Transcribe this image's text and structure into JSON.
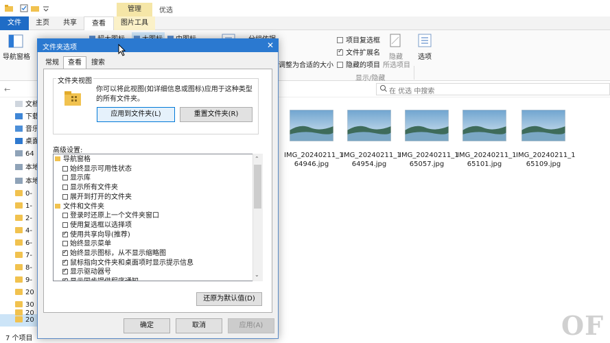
{
  "titlebar": {
    "context_tab": "管理",
    "window_title": "优选"
  },
  "tabs": {
    "file": "文件",
    "home": "主页",
    "share": "共享",
    "view": "查看",
    "picture_tools": "图片工具"
  },
  "ribbon": {
    "nav_pane": "导航窗格",
    "layout_extra_large": "超大图标",
    "layout_large": "大图标",
    "layout_medium": "中图标",
    "group_by": "分组依据",
    "fit_columns": "调整为合适的大小",
    "item_checkboxes": "项目复选框",
    "file_extensions": "文件扩展名",
    "hidden_items": "隐藏的项目",
    "hide_selected_1": "隐藏",
    "hide_selected_2": "所选项目",
    "show_hide_group": "显示/隐藏",
    "options": "选项",
    "item_checkboxes_checked": false,
    "file_extensions_checked": true,
    "hidden_items_checked": false
  },
  "search": {
    "placeholder": "在 优选 中搜索"
  },
  "nav_pane": {
    "items": [
      {
        "label": "文档",
        "icon": "document-icon"
      },
      {
        "label": "下载",
        "icon": "download-icon"
      },
      {
        "label": "音乐",
        "icon": "music-icon"
      },
      {
        "label": "桌面",
        "icon": "desktop-icon"
      },
      {
        "label": "64",
        "icon": "drive-icon"
      },
      {
        "label": "本地",
        "icon": "drive-icon"
      },
      {
        "label": "本地",
        "icon": "drive-icon"
      },
      {
        "label": "0-",
        "icon": "folder-icon"
      },
      {
        "label": "1-",
        "icon": "folder-icon"
      },
      {
        "label": "2-",
        "icon": "folder-icon"
      },
      {
        "label": "4-",
        "icon": "folder-icon"
      },
      {
        "label": "6-",
        "icon": "folder-icon"
      },
      {
        "label": "7-",
        "icon": "folder-icon"
      },
      {
        "label": "8-",
        "icon": "folder-icon"
      },
      {
        "label": "9-",
        "icon": "folder-icon"
      },
      {
        "label": "20",
        "icon": "folder-icon"
      },
      {
        "label": "30",
        "icon": "folder-icon"
      },
      {
        "label": "20",
        "icon": "folder-icon"
      },
      {
        "label": "20",
        "icon": "folder-icon"
      }
    ]
  },
  "files": [
    {
      "name": "IMG_20240211_164946.jpg",
      "line1": "IMG_20240211_1",
      "line2": "64946.jpg"
    },
    {
      "name": "IMG_20240211_164954.jpg",
      "line1": "IMG_20240211_1",
      "line2": "64954.jpg"
    },
    {
      "name": "IMG_20240211_165057.jpg",
      "line1": "IMG_20240211_1",
      "line2": "65057.jpg"
    },
    {
      "name": "IMG_20240211_165101.jpg",
      "line1": "IMG_20240211_1",
      "line2": "65101.jpg"
    },
    {
      "name": "IMG_20240211_165109.jpg",
      "line1": "IMG_20240211_1",
      "line2": "65109.jpg"
    }
  ],
  "status_bar": {
    "item_count": "7 个项目"
  },
  "dialog": {
    "title": "文件夹选项",
    "tabs": [
      "常规",
      "查看",
      "搜索"
    ],
    "folder_view_group": "文件夹视图",
    "folder_view_desc": "你可以将此视图(如详细信息或图标)应用于这种类型的所有文件夹。",
    "apply_to_folders": "应用到文件夹(L)",
    "reset_folders": "重置文件夹(R)",
    "advanced_label": "高级设置:",
    "advanced_items": [
      {
        "type": "folder",
        "label": "导航窗格"
      },
      {
        "type": "check",
        "label": "始终显示可用性状态",
        "checked": false
      },
      {
        "type": "check",
        "label": "显示库",
        "checked": false
      },
      {
        "type": "check",
        "label": "显示所有文件夹",
        "checked": false
      },
      {
        "type": "check",
        "label": "展开到打开的文件夹",
        "checked": false
      },
      {
        "type": "folder",
        "label": "文件和文件夹"
      },
      {
        "type": "check",
        "label": "登录时还原上一个文件夹窗口",
        "checked": false
      },
      {
        "type": "check",
        "label": "使用复选框以选择项",
        "checked": false
      },
      {
        "type": "check",
        "label": "使用共享向导(推荐)",
        "checked": true
      },
      {
        "type": "check",
        "label": "始终显示菜单",
        "checked": false
      },
      {
        "type": "check",
        "label": "始终显示图标，从不显示缩略图",
        "checked": true
      },
      {
        "type": "check",
        "label": "鼠标指向文件夹和桌面项时显示提示信息",
        "checked": true
      },
      {
        "type": "check",
        "label": "显示驱动器号",
        "checked": true
      },
      {
        "type": "check",
        "label": "显示同步提供程序通知",
        "checked": true
      }
    ],
    "restore_defaults": "还原为默认值(D)",
    "ok": "确定",
    "cancel": "取消",
    "apply": "应用(A)"
  },
  "watermark": "OF"
}
